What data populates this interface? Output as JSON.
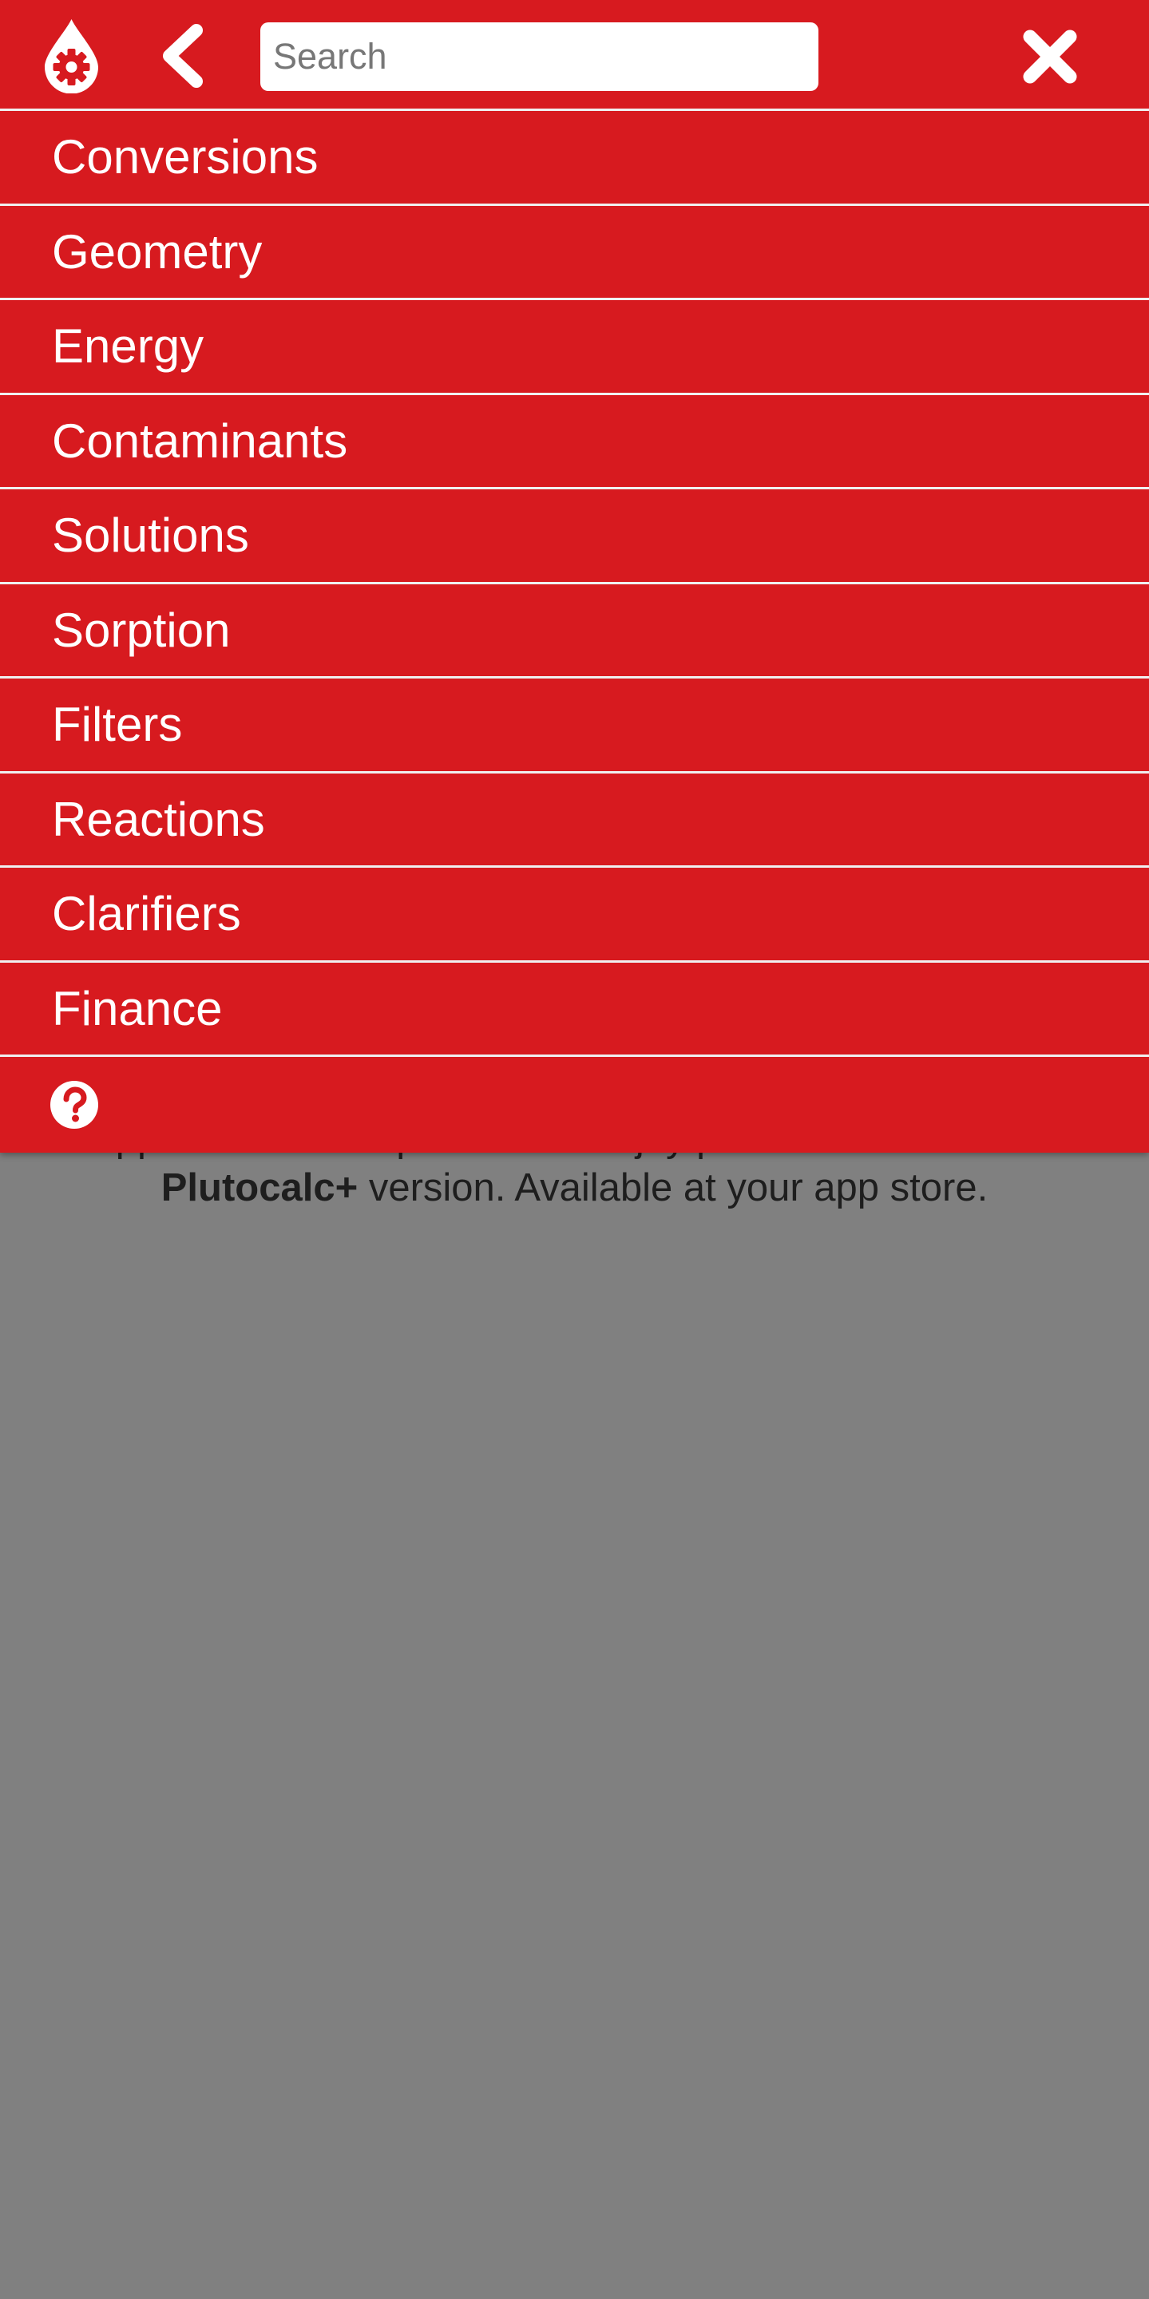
{
  "promo": {
    "line1": "Support the development and enjoy premium features with",
    "brand": "Plutocalc+",
    "line2_rest": " version. Available at your app store."
  },
  "header": {
    "logo_icon": "drop-gear-icon",
    "back_icon": "chevron-left-icon",
    "search_placeholder": "Search",
    "search_value": "",
    "close_icon": "close-icon"
  },
  "menu": {
    "items": [
      {
        "label": "Conversions"
      },
      {
        "label": "Geometry"
      },
      {
        "label": "Energy"
      },
      {
        "label": "Contaminants"
      },
      {
        "label": "Solutions"
      },
      {
        "label": "Sorption"
      },
      {
        "label": "Filters"
      },
      {
        "label": "Reactions"
      },
      {
        "label": "Clarifiers"
      },
      {
        "label": "Finance"
      }
    ],
    "help_icon": "help-circle-icon"
  },
  "colors": {
    "accent": "#d71a1f",
    "divider": "#f0f0f0",
    "dim_background": "#808080",
    "text_on_accent": "#ffffff"
  }
}
